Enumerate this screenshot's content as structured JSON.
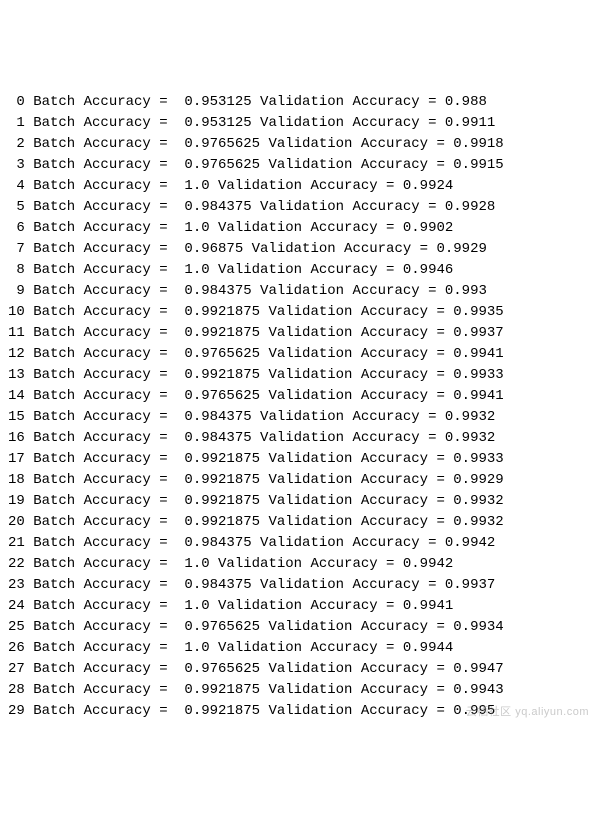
{
  "rows": [
    {
      "idx": 0,
      "batch": "0.953125",
      "val": "0.988"
    },
    {
      "idx": 1,
      "batch": "0.953125",
      "val": "0.9911"
    },
    {
      "idx": 2,
      "batch": "0.9765625",
      "val": "0.9918"
    },
    {
      "idx": 3,
      "batch": "0.9765625",
      "val": "0.9915"
    },
    {
      "idx": 4,
      "batch": "1.0",
      "val": "0.9924"
    },
    {
      "idx": 5,
      "batch": "0.984375",
      "val": "0.9928"
    },
    {
      "idx": 6,
      "batch": "1.0",
      "val": "0.9902"
    },
    {
      "idx": 7,
      "batch": "0.96875",
      "val": "0.9929"
    },
    {
      "idx": 8,
      "batch": "1.0",
      "val": "0.9946"
    },
    {
      "idx": 9,
      "batch": "0.984375",
      "val": "0.993"
    },
    {
      "idx": 10,
      "batch": "0.9921875",
      "val": "0.9935"
    },
    {
      "idx": 11,
      "batch": "0.9921875",
      "val": "0.9937"
    },
    {
      "idx": 12,
      "batch": "0.9765625",
      "val": "0.9941"
    },
    {
      "idx": 13,
      "batch": "0.9921875",
      "val": "0.9933"
    },
    {
      "idx": 14,
      "batch": "0.9765625",
      "val": "0.9941"
    },
    {
      "idx": 15,
      "batch": "0.984375",
      "val": "0.9932"
    },
    {
      "idx": 16,
      "batch": "0.984375",
      "val": "0.9932"
    },
    {
      "idx": 17,
      "batch": "0.9921875",
      "val": "0.9933"
    },
    {
      "idx": 18,
      "batch": "0.9921875",
      "val": "0.9929"
    },
    {
      "idx": 19,
      "batch": "0.9921875",
      "val": "0.9932"
    },
    {
      "idx": 20,
      "batch": "0.9921875",
      "val": "0.9932"
    },
    {
      "idx": 21,
      "batch": "0.984375",
      "val": "0.9942"
    },
    {
      "idx": 22,
      "batch": "1.0",
      "val": "0.9942"
    },
    {
      "idx": 23,
      "batch": "0.984375",
      "val": "0.9937"
    },
    {
      "idx": 24,
      "batch": "1.0",
      "val": "0.9941"
    },
    {
      "idx": 25,
      "batch": "0.9765625",
      "val": "0.9934"
    },
    {
      "idx": 26,
      "batch": "1.0",
      "val": "0.9944"
    },
    {
      "idx": 27,
      "batch": "0.9765625",
      "val": "0.9947"
    },
    {
      "idx": 28,
      "batch": "0.9921875",
      "val": "0.9943"
    },
    {
      "idx": 29,
      "batch": "0.9921875",
      "val": "0.995"
    }
  ],
  "labels": {
    "batch_prefix": "Batch Accuracy = ",
    "val_prefix": "Validation Accuracy = "
  },
  "watermark": "云栖社区 yq.aliyun.com"
}
